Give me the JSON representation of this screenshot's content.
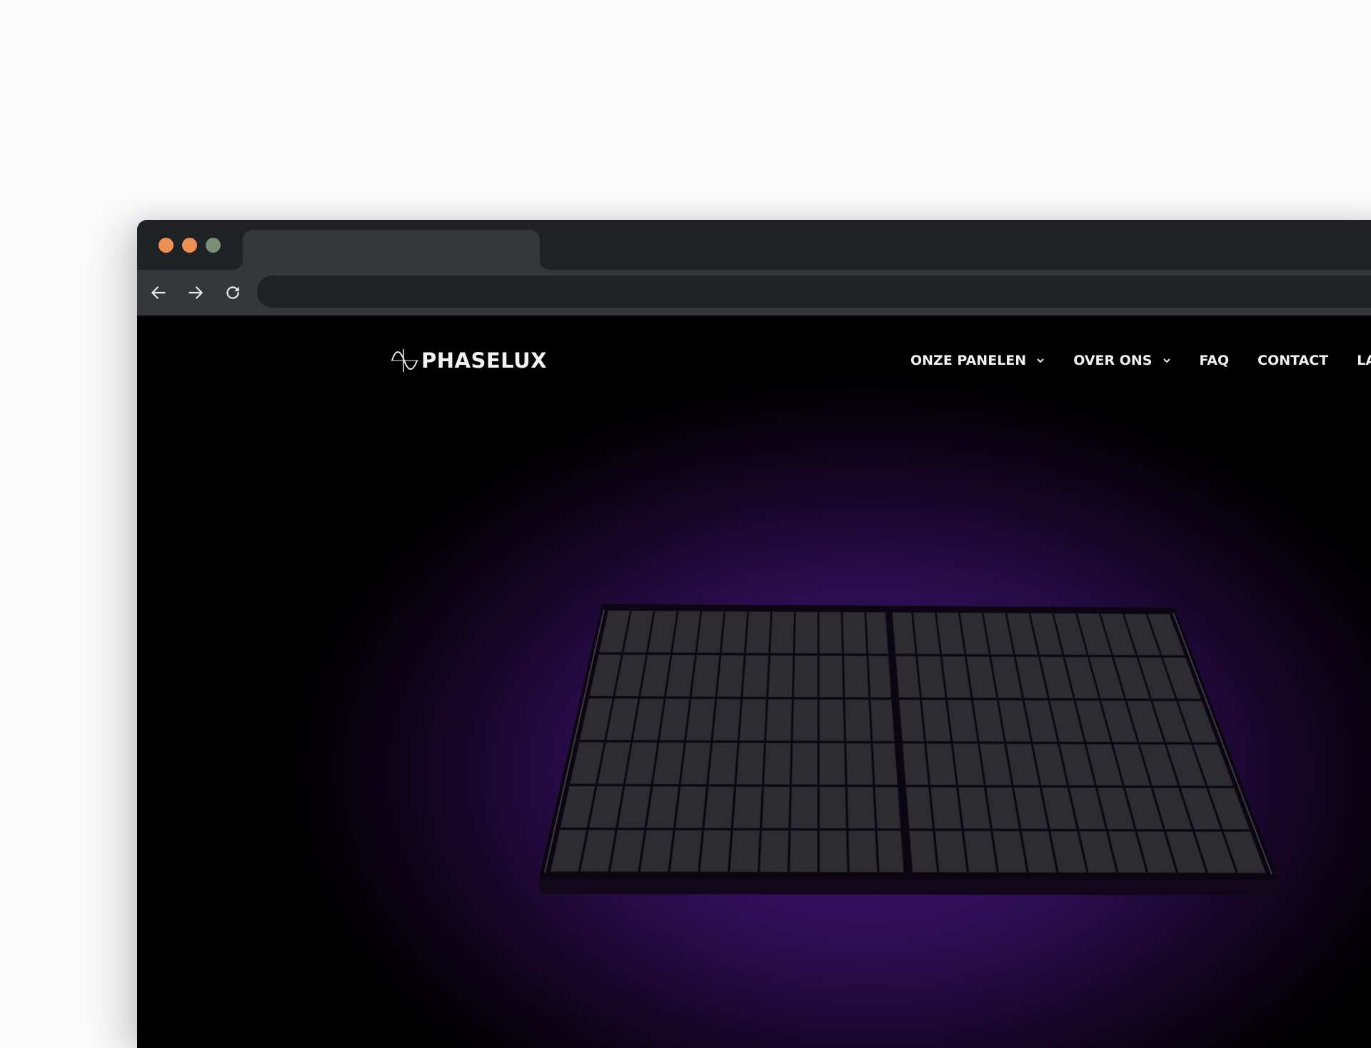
{
  "browser": {
    "window_controls": [
      {
        "name": "close",
        "color": "#ed8e52"
      },
      {
        "name": "minimize",
        "color": "#ed8e52"
      },
      {
        "name": "maximize",
        "color": "#7a8f78"
      }
    ],
    "tab": {
      "title": ""
    },
    "toolbar": {
      "back_icon": "arrow-left-icon",
      "forward_icon": "arrow-right-icon",
      "reload_icon": "reload-icon",
      "address_value": "",
      "address_placeholder": ""
    }
  },
  "site": {
    "logo": {
      "text": "PHASELUX",
      "icon": "sine-wave-icon"
    },
    "nav": [
      {
        "label": "ONZE PANELEN",
        "has_dropdown": true
      },
      {
        "label": "OVER ONS",
        "has_dropdown": true
      },
      {
        "label": "FAQ",
        "has_dropdown": false
      },
      {
        "label": "CONTACT",
        "has_dropdown": false
      },
      {
        "label": "LANG",
        "has_dropdown": false
      }
    ],
    "hero": {
      "visual": "solar-panel-3d",
      "panel": {
        "halves": 2,
        "columns_per_half": 12,
        "rows": 6
      },
      "colors": {
        "glow": "#44157a",
        "background": "#000000",
        "cell": "#2d2c30",
        "frame": "#0c0612"
      }
    }
  }
}
